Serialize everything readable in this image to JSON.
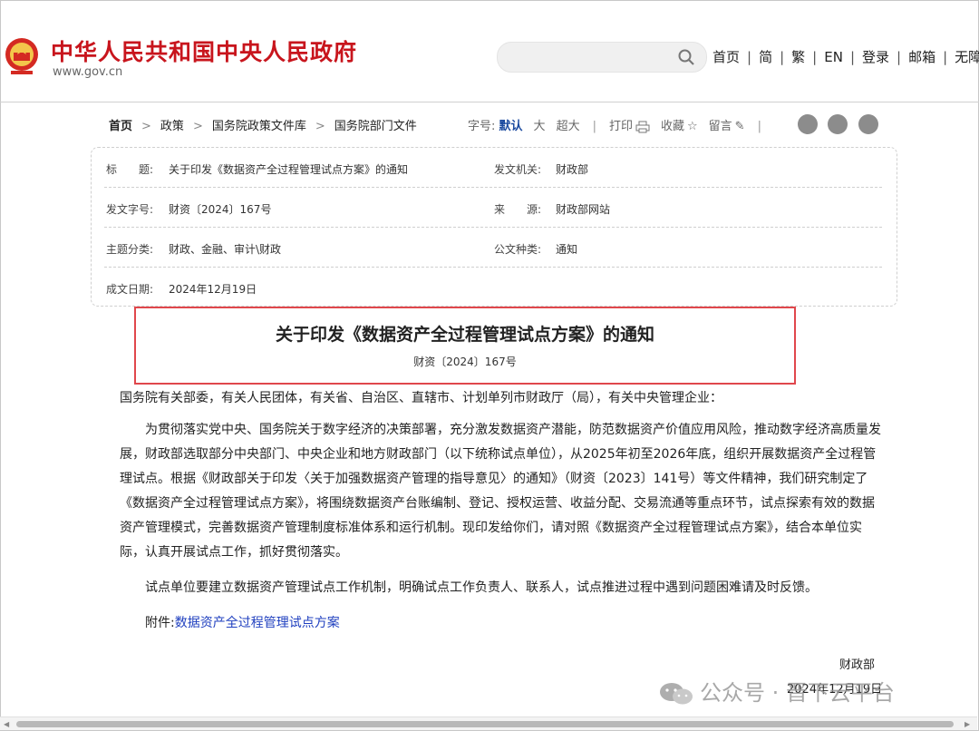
{
  "header": {
    "site_title": "中华人民共和国中央人民政府",
    "site_url": "www.gov.cn",
    "search_placeholder": "",
    "nav": [
      "首页",
      "简",
      "繁",
      "EN",
      "登录",
      "邮箱",
      "无障"
    ]
  },
  "breadcrumb": [
    "首页",
    "政策",
    "国务院政策文件库",
    "国务院部门文件"
  ],
  "tools": {
    "font_label": "字号:",
    "font_default": "默认",
    "font_large": "大",
    "font_xlarge": "超大",
    "print": "打印",
    "favorite": "收藏",
    "comment": "留言"
  },
  "info": {
    "title_label": "标　　题:",
    "title_value": "关于印发《数据资产全过程管理试点方案》的通知",
    "issuer_label": "发文机关:",
    "issuer_value": "财政部",
    "docnum_label": "发文字号:",
    "docnum_value": "财资〔2024〕167号",
    "source_label": "来　　源:",
    "source_value": "财政部网站",
    "topic_label": "主题分类:",
    "topic_value": "财政、金融、审计\\财政",
    "doctype_label": "公文种类:",
    "doctype_value": "通知",
    "date_label": "成文日期:",
    "date_value": "2024年12月19日"
  },
  "document": {
    "title": "关于印发《数据资产全过程管理试点方案》的通知",
    "number": "财资〔2024〕167号",
    "salutation": "国务院有关部委，有关人民团体，有关省、自治区、直辖市、计划单列市财政厅（局），有关中央管理企业：",
    "para1": "为贯彻落实党中央、国务院关于数字经济的决策部署，充分激发数据资产潜能，防范数据资产价值应用风险，推动数字经济高质量发展，财政部选取部分中央部门、中央企业和地方财政部门（以下统称试点单位），从2025年初至2026年底，组织开展数据资产全过程管理试点。根据《财政部关于印发〈关于加强数据资产管理的指导意见〉的通知》（财资〔2023〕141号）等文件精神，我们研究制定了《数据资产全过程管理试点方案》，将围绕数据资产台账编制、登记、授权运营、收益分配、交易流通等重点环节，试点探索有效的数据资产管理模式，完善数据资产管理制度标准体系和运行机制。现印发给你们，请对照《数据资产全过程管理试点方案》，结合本单位实际，认真开展试点工作，抓好贯彻落实。",
    "para2": "试点单位要建立数据资产管理试点工作机制，明确试点工作负责人、联系人，试点推进过程中遇到问题困难请及时反馈。",
    "attachment_label": "附件:",
    "attachment_link": "数据资产全过程管理试点方案",
    "sign_org": "财政部",
    "sign_date": "2024年12月19日"
  },
  "watermark": "公众号 · 晋下云平台",
  "colors": {
    "brand_red": "#c8151d",
    "highlight_border": "#e0474c",
    "link_blue": "#1f3fbf",
    "active_blue": "#1b4a9f"
  }
}
